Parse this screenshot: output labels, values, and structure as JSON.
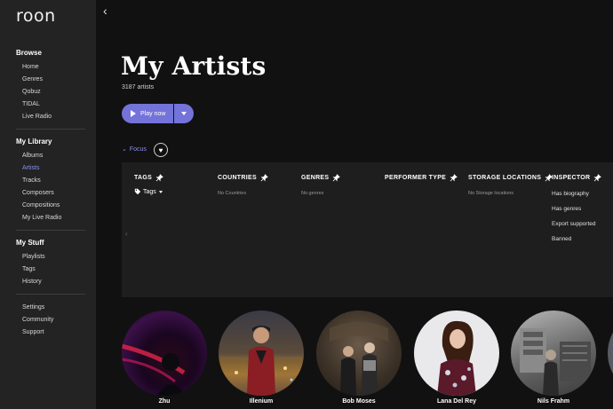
{
  "app": {
    "logo": "roon"
  },
  "sidebar": {
    "browse": {
      "title": "Browse",
      "items": [
        "Home",
        "Genres",
        "Qobuz",
        "TIDAL",
        "Live Radio"
      ]
    },
    "library": {
      "title": "My Library",
      "items": [
        "Albums",
        "Artists",
        "Tracks",
        "Composers",
        "Compositions",
        "My Live Radio"
      ],
      "active": "Artists"
    },
    "stuff": {
      "title": "My Stuff",
      "items": [
        "Playlists",
        "Tags",
        "History"
      ]
    },
    "misc": {
      "items": [
        "Settings",
        "Community",
        "Support"
      ]
    }
  },
  "header": {
    "back_icon": "chevron-left-icon",
    "title": "My Artists",
    "subtitle": "3187 artists"
  },
  "actions": {
    "play_now": "Play now",
    "focus": "Focus"
  },
  "focus_panel": {
    "tags": {
      "header": "TAGS",
      "button": "Tags"
    },
    "countries": {
      "header": "COUNTRIES",
      "value": "No Countries"
    },
    "genres": {
      "header": "GENRES",
      "value": "No genres"
    },
    "performer_type": {
      "header": "PERFORMER TYPE"
    },
    "storage": {
      "header": "STORAGE LOCATIONS",
      "value": "No Storage locations"
    },
    "inspector": {
      "header": "INSPECTOR",
      "items": [
        "Has biography",
        "Has genres",
        "Export supported",
        "Banned"
      ]
    }
  },
  "artists": [
    {
      "name": "Zhu"
    },
    {
      "name": "Illenium"
    },
    {
      "name": "Bob Moses"
    },
    {
      "name": "Lana Del Rey"
    },
    {
      "name": "Nils Frahm"
    }
  ],
  "colors": {
    "accent": "#7373d9",
    "accent_text": "#8e8ef5",
    "sidebar_bg": "#232323",
    "main_bg": "#111111",
    "panel_bg": "#1e1e1e"
  }
}
